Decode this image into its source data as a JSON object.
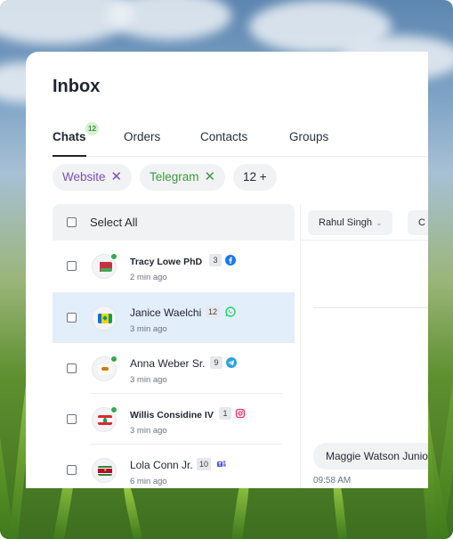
{
  "inbox": {
    "title": "Inbox"
  },
  "tabs": [
    {
      "label": "Chats",
      "badge": "12",
      "active": true
    },
    {
      "label": "Orders"
    },
    {
      "label": "Contacts"
    },
    {
      "label": "Groups"
    }
  ],
  "filters": {
    "chips": [
      {
        "label": "Website",
        "color": "#7a4fb8",
        "close": "✕"
      },
      {
        "label": "Telegram",
        "color": "#3b9a3f",
        "close": "✕"
      }
    ],
    "more": "12 +"
  },
  "list": {
    "select_all": "Select All",
    "rows": [
      {
        "name": "Tracy Lowe PhD",
        "time": "2 min ago",
        "count": "3",
        "channel": "facebook-icon",
        "flag": "belarus",
        "online": true,
        "bold": true,
        "selected": false
      },
      {
        "name": "Janice Waelchi",
        "time": "3 min ago",
        "count": "12",
        "channel": "whatsapp-icon",
        "flag": "saint-vincent",
        "online": false,
        "bold": false,
        "selected": true
      },
      {
        "name": "Anna Weber Sr.",
        "time": "3 min ago",
        "count": "9",
        "channel": "telegram-icon",
        "flag": "cyprus",
        "online": true,
        "bold": false,
        "selected": false
      },
      {
        "name": "Willis Considine IV",
        "time": "3 min ago",
        "count": "1",
        "channel": "instagram-icon",
        "flag": "lebanon",
        "online": true,
        "bold": true,
        "selected": false
      },
      {
        "name": "Lola Conn Jr.",
        "time": "6 min ago",
        "count": "10",
        "channel": "teams-icon",
        "flag": "suriname",
        "online": false,
        "bold": false,
        "selected": false
      }
    ]
  },
  "conversation": {
    "agent_filter": "Rahul Singh",
    "second_filter": "C",
    "message": "Maggie Watson Junio",
    "message_time": "09:58 AM"
  },
  "colors": {
    "selected_row": "#e3eefb",
    "online": "#34a853",
    "tab_badge_bg": "#d6f0d2",
    "chevron": "#6b8fd6"
  }
}
